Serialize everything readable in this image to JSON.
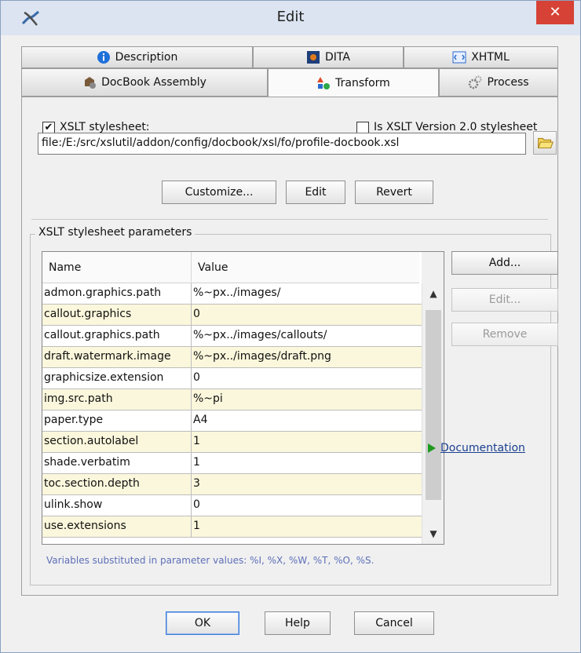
{
  "window": {
    "title": "Edit",
    "close_label": "✕",
    "app_icon": "oxygen-app-icon"
  },
  "tabs": {
    "row1": [
      {
        "label": "Description",
        "icon": "info-icon"
      },
      {
        "label": "DITA",
        "icon": "dita-icon"
      },
      {
        "label": "XHTML",
        "icon": "xhtml-icon"
      }
    ],
    "row2": [
      {
        "label": "DocBook Assembly",
        "icon": "docbook-assembly-icon"
      },
      {
        "label": "Transform",
        "icon": "transform-icon",
        "active": true
      },
      {
        "label": "Process",
        "icon": "gears-icon"
      }
    ]
  },
  "transform": {
    "xslt_checkbox_label": "XSLT stylesheet:",
    "xslt_checked": "✔",
    "xslt2_checkbox_label": "Is XSLT Version 2.0 stylesheet",
    "path_value": "file:/E:/src/xslutil/addon/config/docbook/xsl/fo/profile-docbook.xsl",
    "customize_label": "Customize...",
    "edit_label": "Edit",
    "revert_label": "Revert"
  },
  "params": {
    "group_title": "XSLT stylesheet parameters",
    "col_name": "Name",
    "col_value": "Value",
    "rows": [
      {
        "name": "admon.graphics.path",
        "value": "%~px../images/"
      },
      {
        "name": "callout.graphics",
        "value": "0"
      },
      {
        "name": "callout.graphics.path",
        "value": "%~px../images/callouts/"
      },
      {
        "name": "draft.watermark.image",
        "value": "%~px../images/draft.png"
      },
      {
        "name": "graphicsize.extension",
        "value": "0"
      },
      {
        "name": "img.src.path",
        "value": "%~pi"
      },
      {
        "name": "paper.type",
        "value": "A4"
      },
      {
        "name": "section.autolabel",
        "value": "1"
      },
      {
        "name": "shade.verbatim",
        "value": "1"
      },
      {
        "name": "toc.section.depth",
        "value": "3"
      },
      {
        "name": "ulink.show",
        "value": "0"
      },
      {
        "name": "use.extensions",
        "value": "1"
      }
    ],
    "add_label": "Add...",
    "edit_label": "Edit...",
    "remove_label": "Remove",
    "doc_link": "Documentation",
    "vars_note": "Variables substituted in parameter values: %I, %X, %W, %T, %O, %S."
  },
  "footer": {
    "ok_label": "OK",
    "help_label": "Help",
    "cancel_label": "Cancel"
  },
  "colors": {
    "alt_row": "#fbf7dc",
    "close_button": "#d64235",
    "link": "#1a3f8f",
    "note_text": "#5d6fb8"
  }
}
